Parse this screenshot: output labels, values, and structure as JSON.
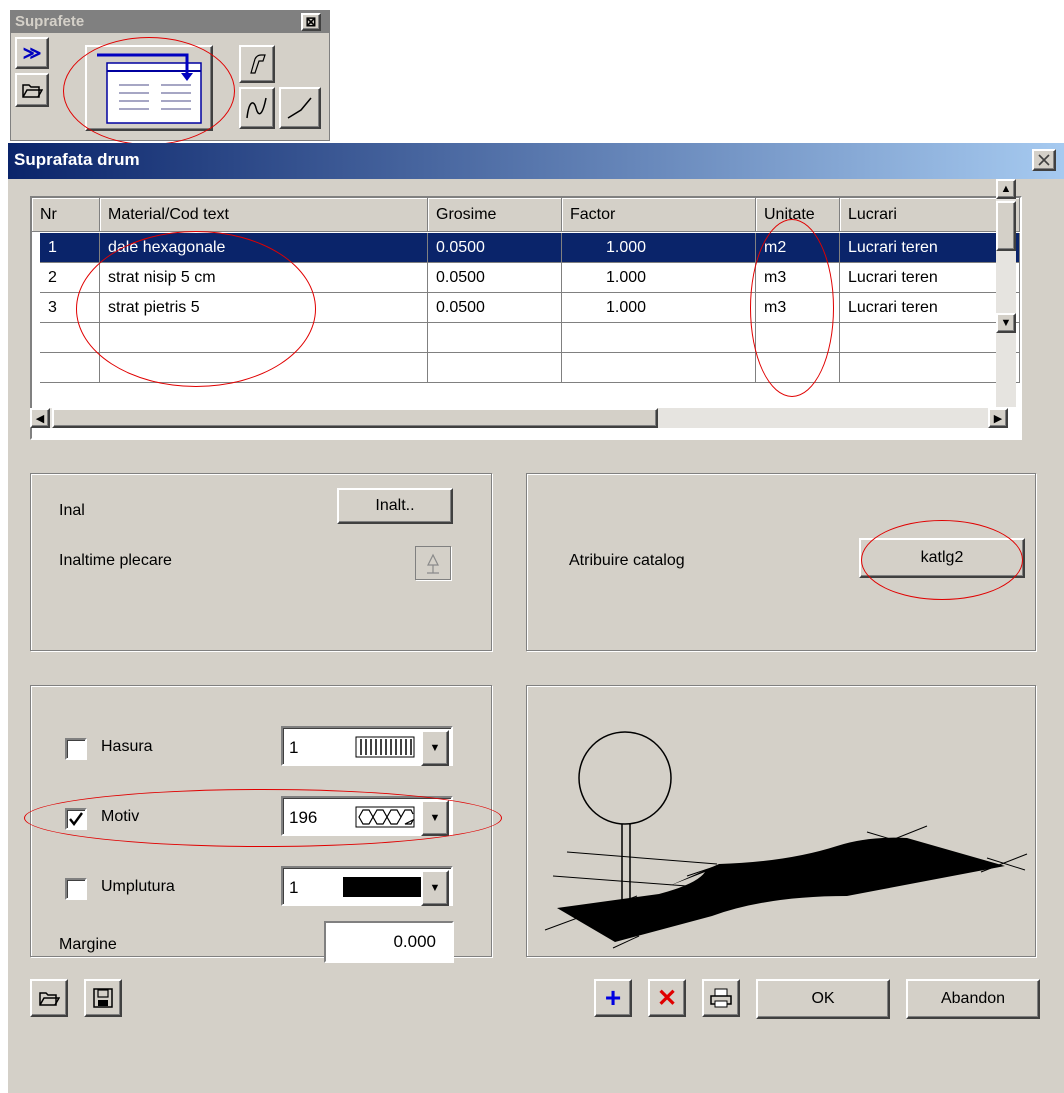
{
  "toolbar": {
    "title": "Suprafete",
    "close_glyph": "⊠",
    "expand_glyph": "≫",
    "icons": [
      "expand-icon",
      "open-folder-icon",
      "table-insert-icon",
      "path-icon",
      "curve-icon",
      "line-icon"
    ]
  },
  "dialog": {
    "title": "Suprafata drum",
    "close_glyph": "✕"
  },
  "table": {
    "columns": [
      "Nr",
      "Material/Cod text",
      "Grosime",
      "Factor",
      "Unitate",
      "Lucrari"
    ],
    "rows": [
      {
        "nr": "1",
        "material": "dale hexagonale",
        "grosime": "0.0500",
        "factor": "1.000",
        "unitate": "m2",
        "lucrari": "Lucrari teren"
      },
      {
        "nr": "2",
        "material": "strat nisip 5 cm",
        "grosime": "0.0500",
        "factor": "1.000",
        "unitate": "m3",
        "lucrari": "Lucrari teren"
      },
      {
        "nr": "3",
        "material": "strat pietris 5",
        "grosime": "0.0500",
        "factor": "1.000",
        "unitate": "m3",
        "lucrari": "Lucrari teren"
      },
      {
        "nr": "",
        "material": "",
        "grosime": "",
        "factor": "",
        "unitate": "",
        "lucrari": ""
      },
      {
        "nr": "",
        "material": "",
        "grosime": "",
        "factor": "",
        "unitate": "",
        "lucrari": ""
      }
    ],
    "selected_row": 0
  },
  "height_group": {
    "inal_label": "Inal",
    "inalt_button": "Inalt..",
    "start_height_label": "Inaltime plecare"
  },
  "catalog_group": {
    "label": "Atribuire catalog",
    "button": "katlg2"
  },
  "pattern_group": {
    "hasura": {
      "label": "Hasura",
      "checked": false,
      "value": "1"
    },
    "motiv": {
      "label": "Motiv",
      "checked": true,
      "value": "196"
    },
    "umplutura": {
      "label": "Umplutura",
      "checked": false,
      "value": "1"
    },
    "margine": {
      "label": "Margine",
      "value": "0.000"
    }
  },
  "footer": {
    "ok_button": "OK",
    "cancel_button": "Abandon",
    "add_glyph": "+",
    "delete_glyph": "✕",
    "icons": [
      "open-folder-icon",
      "save-icon",
      "add-icon",
      "delete-icon",
      "print-icon"
    ]
  },
  "colors": {
    "accent_blue": "#0a246a",
    "annotation_red": "#e00000",
    "dialog_bg": "#d4d0c8"
  }
}
